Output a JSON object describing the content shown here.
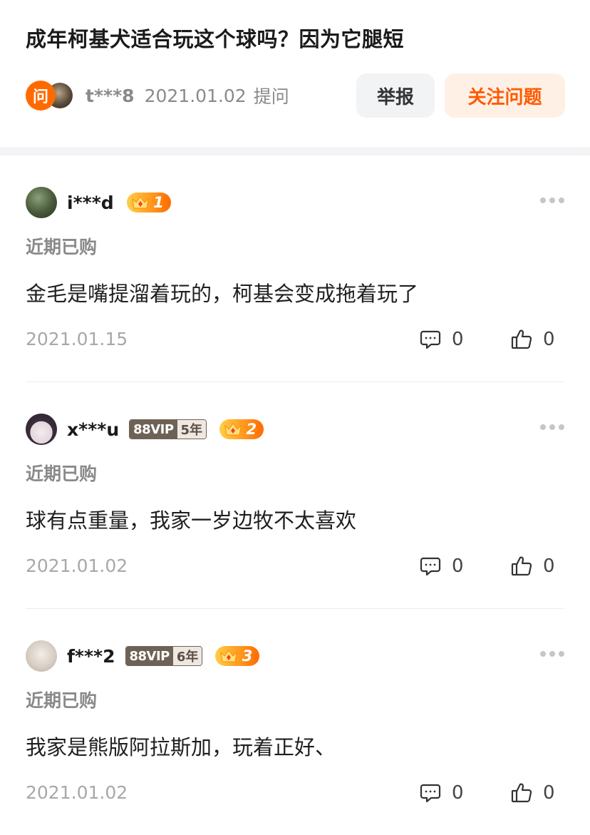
{
  "question": {
    "title": "成年柯基犬适合玩这个球吗？因为它腿短",
    "ask_badge": "问",
    "user": "t***8",
    "date": "2021.01.02",
    "ask_label": "提问",
    "report_label": "举报",
    "follow_label": "关注问题"
  },
  "colors": {
    "accent": "#ff5a00",
    "follow_bg": "#fff0e6",
    "report_bg": "#f2f3f5",
    "muted_text": "#8a8a8a"
  },
  "icons": [
    "ask-icon",
    "more-icon",
    "comment-icon",
    "thumbs-up-icon",
    "crown-icon"
  ],
  "answers": [
    {
      "user": "i***d",
      "level": "1",
      "tag": "近期已购",
      "text": "金毛是嘴提溜着玩的，柯基会变成拖着玩了",
      "date": "2021.01.15",
      "comments": "0",
      "likes": "0"
    },
    {
      "user": "x***u",
      "vip_label": "88VIP",
      "vip_years": "5年",
      "level": "2",
      "tag": "近期已购",
      "text": "球有点重量，我家一岁边牧不太喜欢",
      "date": "2021.01.02",
      "comments": "0",
      "likes": "0"
    },
    {
      "user": "f***2",
      "vip_label": "88VIP",
      "vip_years": "6年",
      "level": "3",
      "tag": "近期已购",
      "text": "我家是熊版阿拉斯加，玩着正好、",
      "date": "2021.01.02",
      "comments": "0",
      "likes": "0"
    }
  ]
}
